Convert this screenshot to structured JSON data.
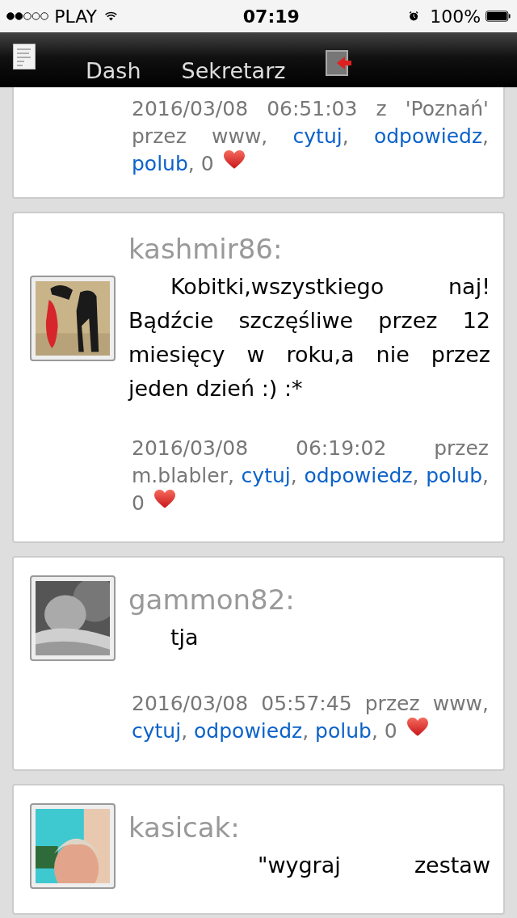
{
  "status_bar": {
    "carrier": "PLAY",
    "time": "07:19",
    "battery": "100%"
  },
  "nav": {
    "items": [
      {
        "label": "Dash"
      },
      {
        "label": "Sekretarz"
      }
    ]
  },
  "posts": [
    {
      "meta": [
        {
          "kind": "text",
          "text": "2016/03/08 06:51:03 z 'Poznań' przez www, "
        },
        {
          "kind": "link",
          "text": "cytuj"
        },
        {
          "kind": "text",
          "text": ", "
        },
        {
          "kind": "link",
          "text": "odpowiedz"
        },
        {
          "kind": "text",
          "text": ", "
        },
        {
          "kind": "link",
          "text": "polub"
        },
        {
          "kind": "text",
          "text": ", 0"
        }
      ]
    },
    {
      "author": "kashmir86:",
      "body": "Kobitki,wszystkiego naj! Bądźcie szczęśliwe przez 12 miesięcy w roku,a nie przez jeden dzień :) :*",
      "meta": [
        {
          "kind": "text",
          "text": "2016/03/08 06:19:02 przez m.blabler, "
        },
        {
          "kind": "link",
          "text": "cytuj"
        },
        {
          "kind": "text",
          "text": ", "
        },
        {
          "kind": "link",
          "text": "odpowiedz"
        },
        {
          "kind": "text",
          "text": ", "
        },
        {
          "kind": "link",
          "text": "polub"
        },
        {
          "kind": "text",
          "text": ", 0"
        }
      ]
    },
    {
      "author": "gammon82:",
      "body": "tja",
      "meta": [
        {
          "kind": "text",
          "text": "2016/03/08 05:57:45 przez www, "
        },
        {
          "kind": "link",
          "text": "cytuj"
        },
        {
          "kind": "text",
          "text": ", "
        },
        {
          "kind": "link",
          "text": "odpowiedz"
        },
        {
          "kind": "text",
          "text": ", "
        },
        {
          "kind": "link",
          "text": "polub"
        },
        {
          "kind": "text",
          "text": ", 0"
        }
      ]
    },
    {
      "author": "kasicak:",
      "body": "\"wygraj zestaw"
    }
  ]
}
